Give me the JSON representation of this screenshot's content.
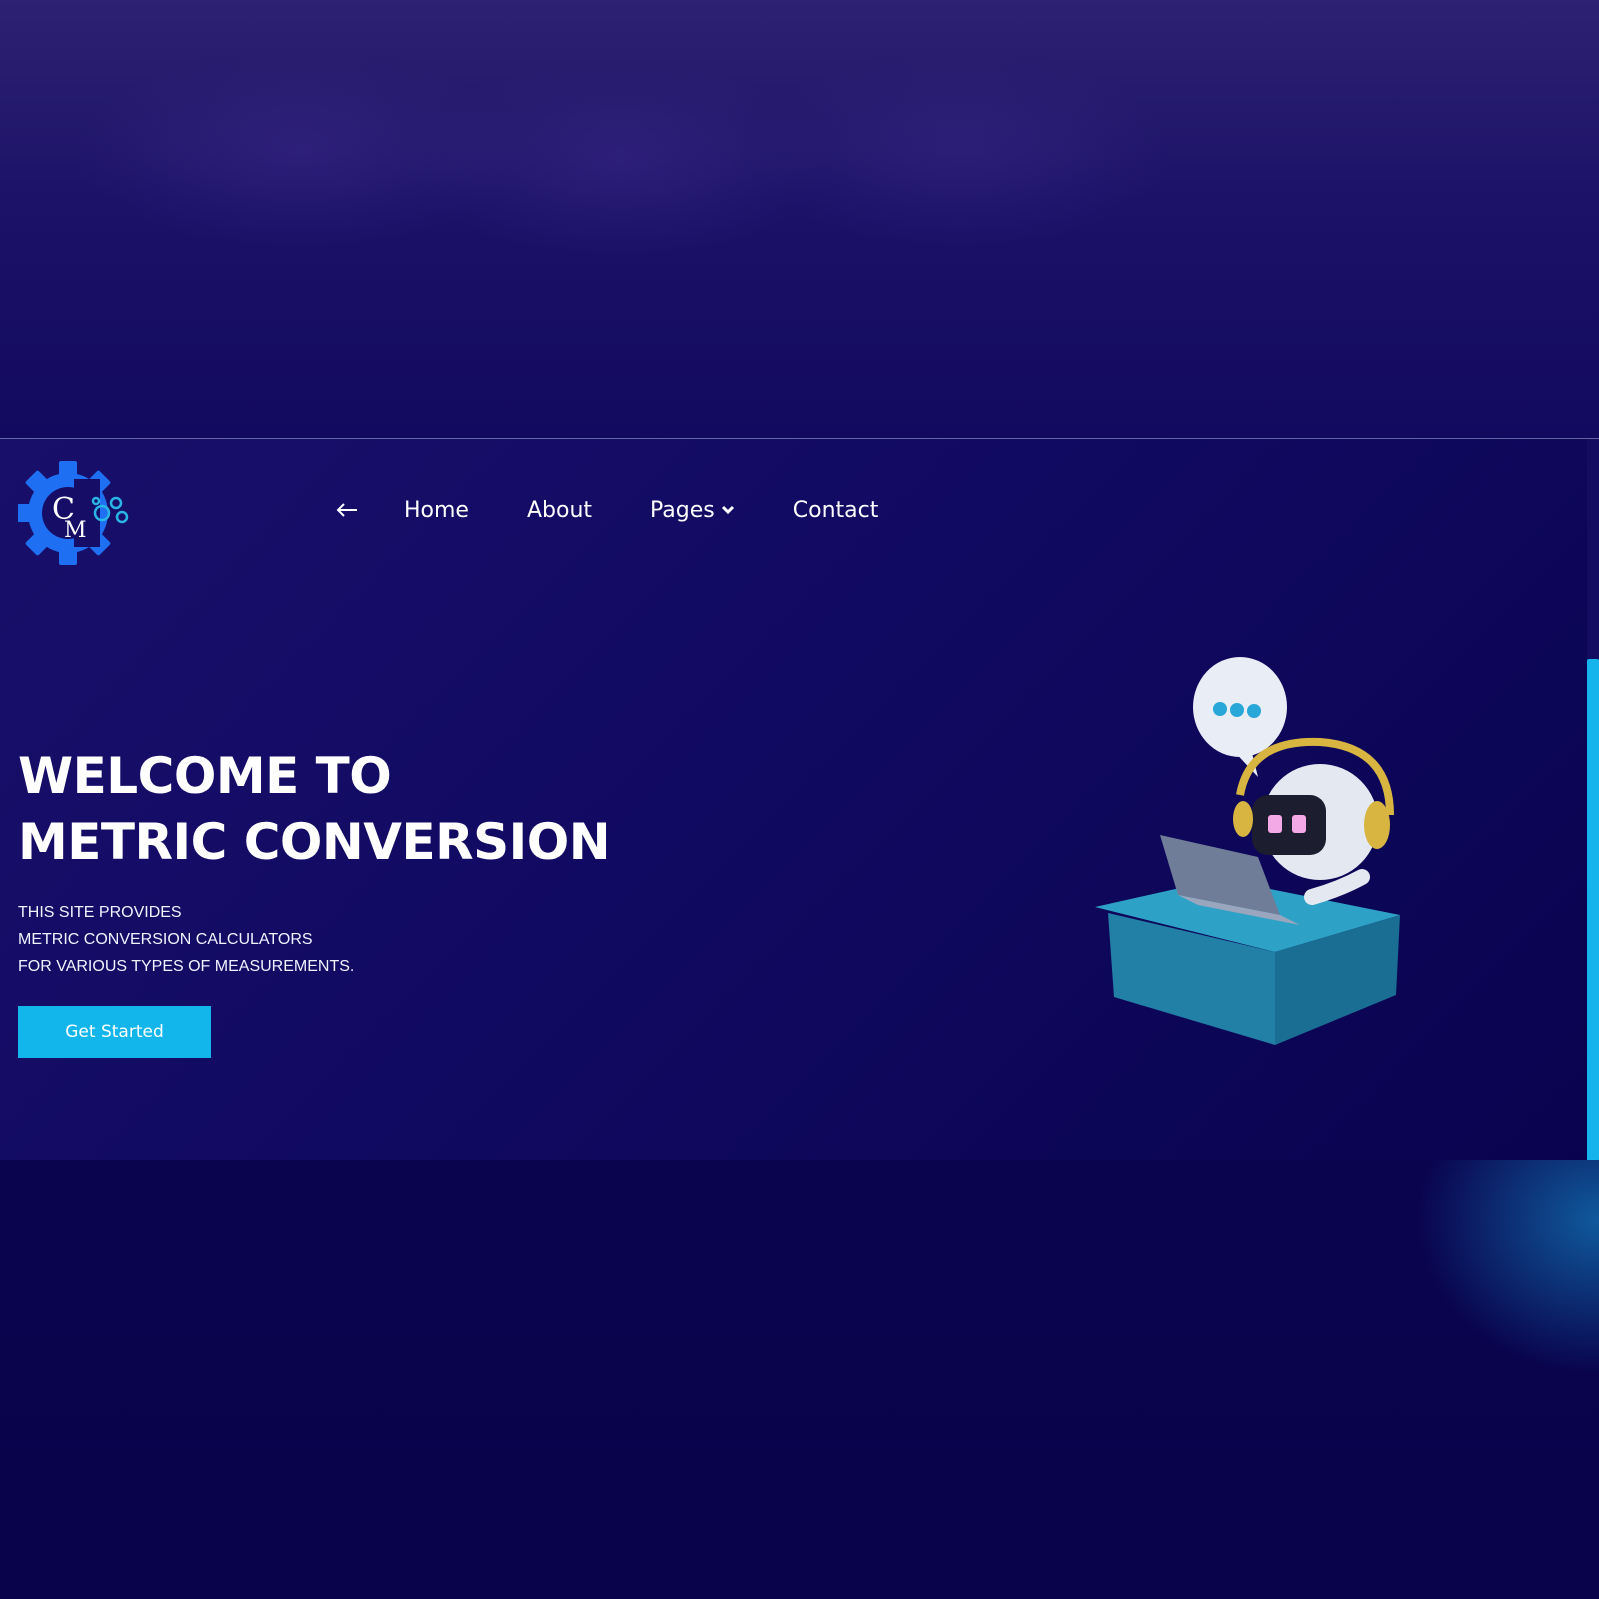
{
  "nav": {
    "back_icon": "arrow-left-icon",
    "items": [
      {
        "label": "Home"
      },
      {
        "label": "About"
      },
      {
        "label": "Pages",
        "icon": "chevron-down-icon"
      },
      {
        "label": "Contact"
      }
    ]
  },
  "logo": {
    "icon": "gear-logo-icon",
    "letters": "CM"
  },
  "hero": {
    "title_line1": "WELCOME TO",
    "title_line2": "METRIC CONVERSION",
    "desc_line1": "THIS SITE PROVIDES",
    "desc_line2": "METRIC CONVERSION CALCULATORS",
    "desc_line3": "FOR VARIOUS TYPES OF MEASUREMENTS.",
    "cta_label": "Get Started"
  },
  "illustration": {
    "icon": "robot-support-illustration"
  },
  "colors": {
    "background": "#0b0552",
    "accent": "#12b6ea",
    "logo_blue": "#1f6ff2",
    "text": "#ffffff"
  }
}
